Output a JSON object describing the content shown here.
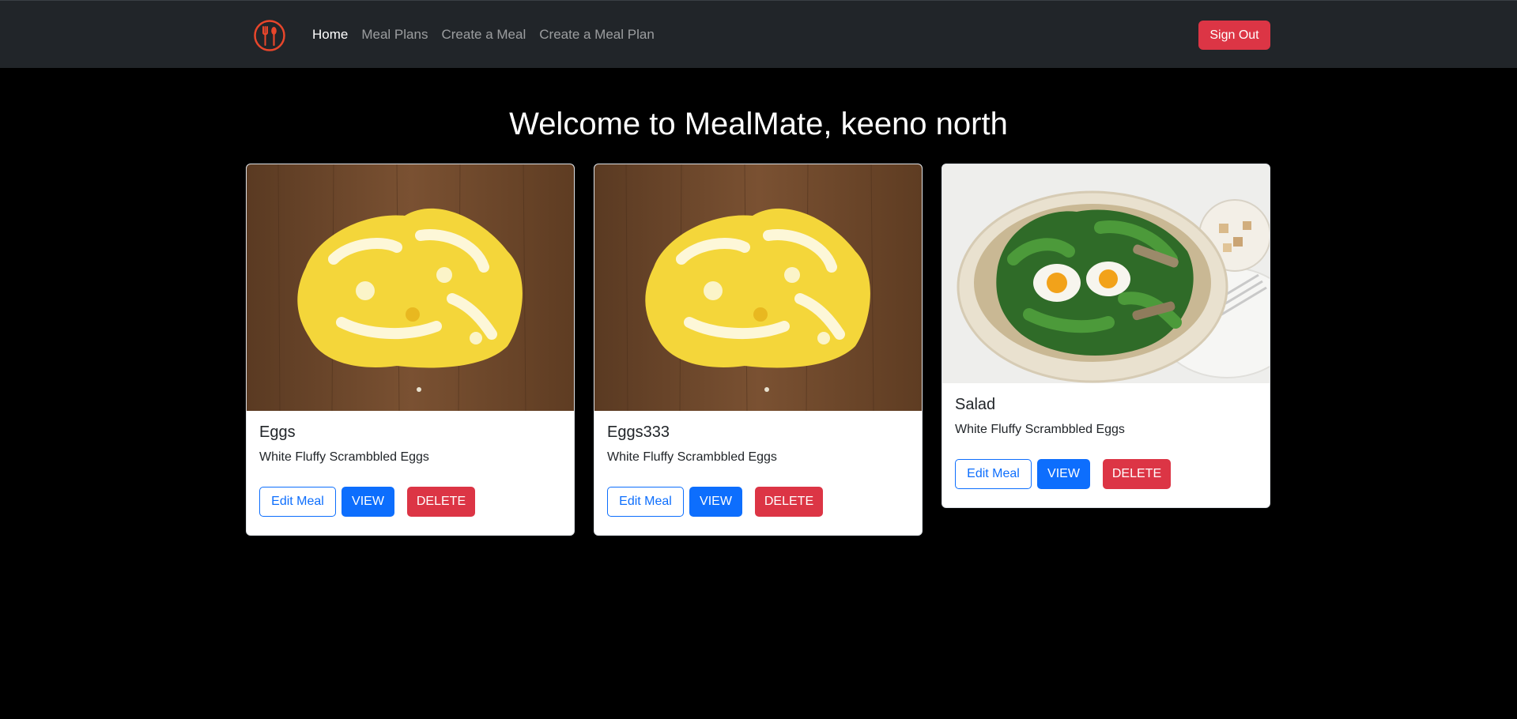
{
  "nav": {
    "logo_icon": "fork-spoon-logo-icon",
    "brand_color": "#e8462b",
    "links": [
      {
        "label": "Home",
        "active": true
      },
      {
        "label": "Meal Plans",
        "active": false
      },
      {
        "label": "Create a Meal",
        "active": false
      },
      {
        "label": "Create a Meal Plan",
        "active": false
      }
    ],
    "sign_out_label": "Sign Out"
  },
  "welcome": "Welcome to MealMate, keeno north",
  "meals": [
    {
      "title": "Eggs",
      "description": "White Fluffy Scrambbled Eggs",
      "image": "scrambled-eggs-photo"
    },
    {
      "title": "Eggs333",
      "description": "White Fluffy Scrambbled Eggs",
      "image": "scrambled-eggs-photo"
    },
    {
      "title": "Salad",
      "description": "White Fluffy Scrambbled Eggs",
      "image": "salad-bowl-photo"
    }
  ],
  "card_actions": {
    "edit_label": "Edit Meal",
    "view_label": "VIEW",
    "delete_label": "DELETE"
  },
  "colors": {
    "primary": "#0d6efd",
    "danger": "#dc3545",
    "navbar": "#212529",
    "background": "#000000"
  }
}
